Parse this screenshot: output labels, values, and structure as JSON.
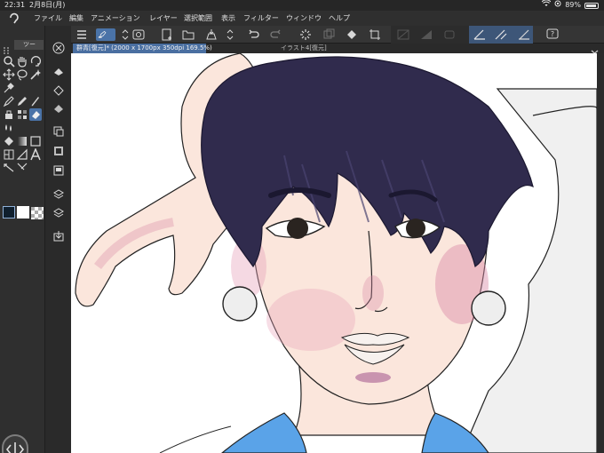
{
  "status_bar": {
    "time": "22:31",
    "date": "2月8日(月)",
    "battery": "89%"
  },
  "menu": {
    "items": [
      "ファイル",
      "編集",
      "アニメーション",
      "レイヤー",
      "選択範囲",
      "表示",
      "フィルター",
      "ウィンドウ",
      "ヘルプ"
    ]
  },
  "left_panel": {
    "tab_label": "ツー"
  },
  "toolbar": {
    "icons": [
      "menu-icon",
      "quick-access-icon",
      "layer-property-icon",
      "new-icon",
      "open-icon",
      "save-icon",
      "undo-icon",
      "redo-icon",
      "loading-icon",
      "transform-icon",
      "fill-icon",
      "crop-icon",
      "selection-icon",
      "snap-icon",
      "ruler-icon",
      "correct-line-icon",
      "pen-pressure-icon",
      "stabilizer-icon",
      "help-icon"
    ]
  },
  "document_tabs": [
    {
      "label": "群青[復元]* (2000 x 1700px 350dpi 169.5%)",
      "active": true
    },
    {
      "label": "イラスト4[復元]",
      "active": false
    }
  ],
  "colors": {
    "accent": "#4a73a8",
    "main_color": "#0f1f2e",
    "sub_color": "#ffffff",
    "hair": "#302b4d",
    "skin": "#fbe6dc",
    "blush": "#d98aa6",
    "shirt": "#5aa3e8",
    "pillow": "#f0f0f0"
  }
}
